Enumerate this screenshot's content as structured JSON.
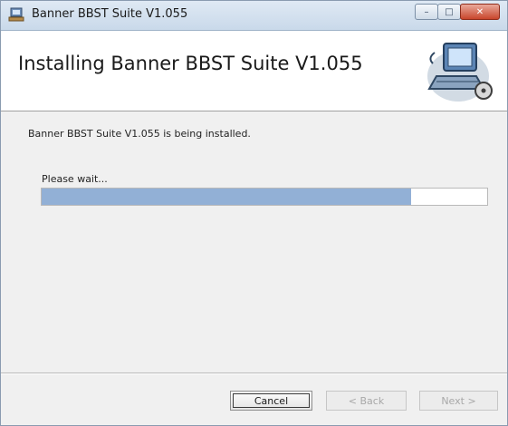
{
  "window": {
    "title": "Banner BBST Suite V1.055",
    "controls": {
      "minimize": "–",
      "maximize": "□",
      "close": "✕"
    }
  },
  "banner": {
    "heading": "Installing Banner BBST Suite V1.055",
    "icon": "computer-setup-icon"
  },
  "body": {
    "status": "Banner BBST Suite V1.055 is being installed.",
    "wait_label": "Please wait...",
    "progress_fraction": 0.83
  },
  "buttons": {
    "cancel": "Cancel",
    "back": "< Back",
    "next": "Next >"
  },
  "colors": {
    "progress_fill": "#92b0d6",
    "close_button": "#c9462c"
  }
}
